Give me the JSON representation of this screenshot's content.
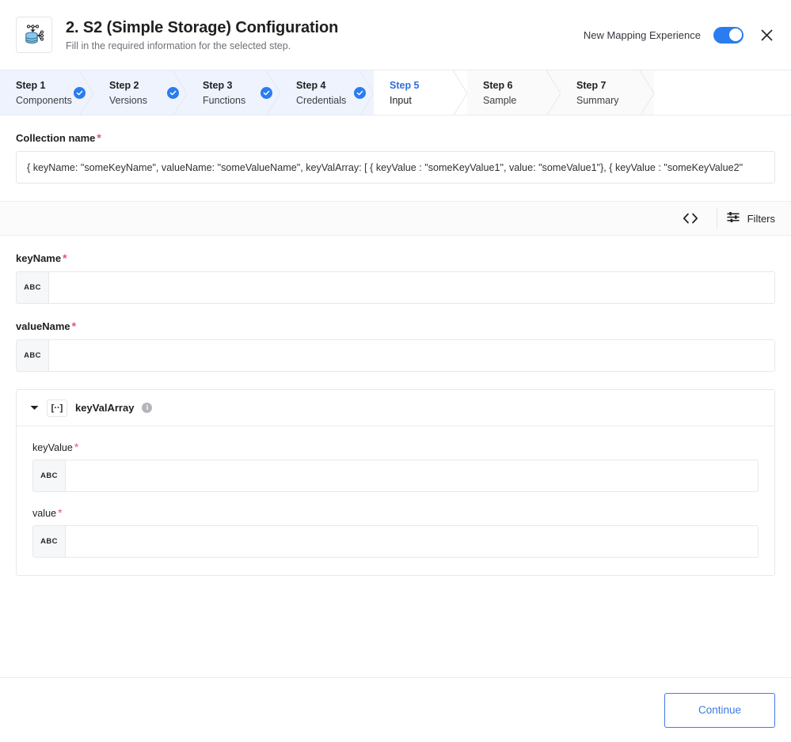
{
  "header": {
    "icon": "database-storage-icon",
    "title": "2. S2 (Simple Storage) Configuration",
    "subtitle": "Fill in the required information for the selected step.",
    "toggle_label": "New Mapping Experience",
    "toggle_on": true,
    "close_label": "×"
  },
  "stepper": {
    "steps": [
      {
        "num": "Step 1",
        "name": "Components",
        "state": "complete"
      },
      {
        "num": "Step 2",
        "name": "Versions",
        "state": "complete"
      },
      {
        "num": "Step 3",
        "name": "Functions",
        "state": "complete"
      },
      {
        "num": "Step 4",
        "name": "Credentials",
        "state": "complete"
      },
      {
        "num": "Step 5",
        "name": "Input",
        "state": "active"
      },
      {
        "num": "Step 6",
        "name": "Sample",
        "state": "pending"
      },
      {
        "num": "Step 7",
        "name": "Summary",
        "state": "pending"
      }
    ]
  },
  "collection": {
    "label": "Collection name",
    "required": "*",
    "value": "{ keyName: \"someKeyName\", valueName: \"someValueName\", keyValArray: [ { keyValue : \"someKeyValue1\", value: \"someValue1\"},  { keyValue : \"someKeyValue2\""
  },
  "toolbar": {
    "code_icon": "<>",
    "filters_icon": "sliders-icon",
    "filters_label": "Filters"
  },
  "fields": {
    "keyName": {
      "label": "keyName",
      "required": "*",
      "type_badge": "ABC",
      "value": ""
    },
    "valueName": {
      "label": "valueName",
      "required": "*",
      "type_badge": "ABC",
      "value": ""
    }
  },
  "array_section": {
    "caret": "▼",
    "type_badge": "[··]",
    "label": "keyValArray",
    "info": "i",
    "children": [
      {
        "label": "keyValue",
        "required": "*",
        "type_badge": "ABC",
        "value": ""
      },
      {
        "label": "value",
        "required": "*",
        "type_badge": "ABC",
        "value": ""
      }
    ]
  },
  "footer": {
    "continue_label": "Continue"
  }
}
